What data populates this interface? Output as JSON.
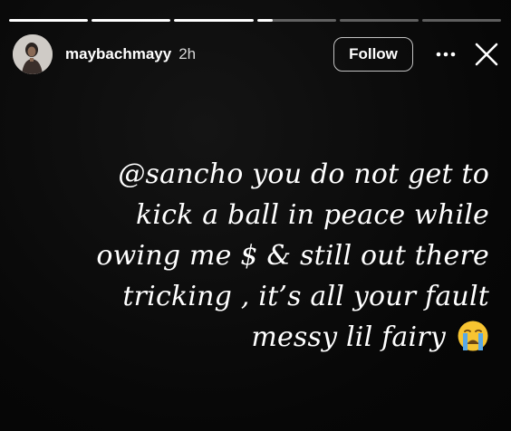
{
  "story": {
    "progress_segments": [
      {
        "fill_fraction": 1.0
      },
      {
        "fill_fraction": 1.0
      },
      {
        "fill_fraction": 1.0
      },
      {
        "fill_fraction": 0.2
      },
      {
        "fill_fraction": 0.0
      },
      {
        "fill_fraction": 0.0
      }
    ],
    "username": "maybachmayy",
    "timestamp": "2h",
    "follow_label": "Follow",
    "more_icon": "ellipsis-icon",
    "close_icon": "close-icon",
    "caption_lines": [
      "@sancho you do not get to",
      "kick a ball in peace while",
      "owing me $ & still out there",
      "tricking , it’s all your fault",
      "messy lil fairy"
    ],
    "caption_emoji": "crying-face-emoji"
  },
  "colors": {
    "background": "#0b0b0b",
    "text": "#ffffff",
    "progress_track": "rgba(255,255,255,0.35)",
    "progress_fill": "#ffffff",
    "emoji_yellow": "#f7c431",
    "emoji_tear": "#5aa9e6"
  }
}
